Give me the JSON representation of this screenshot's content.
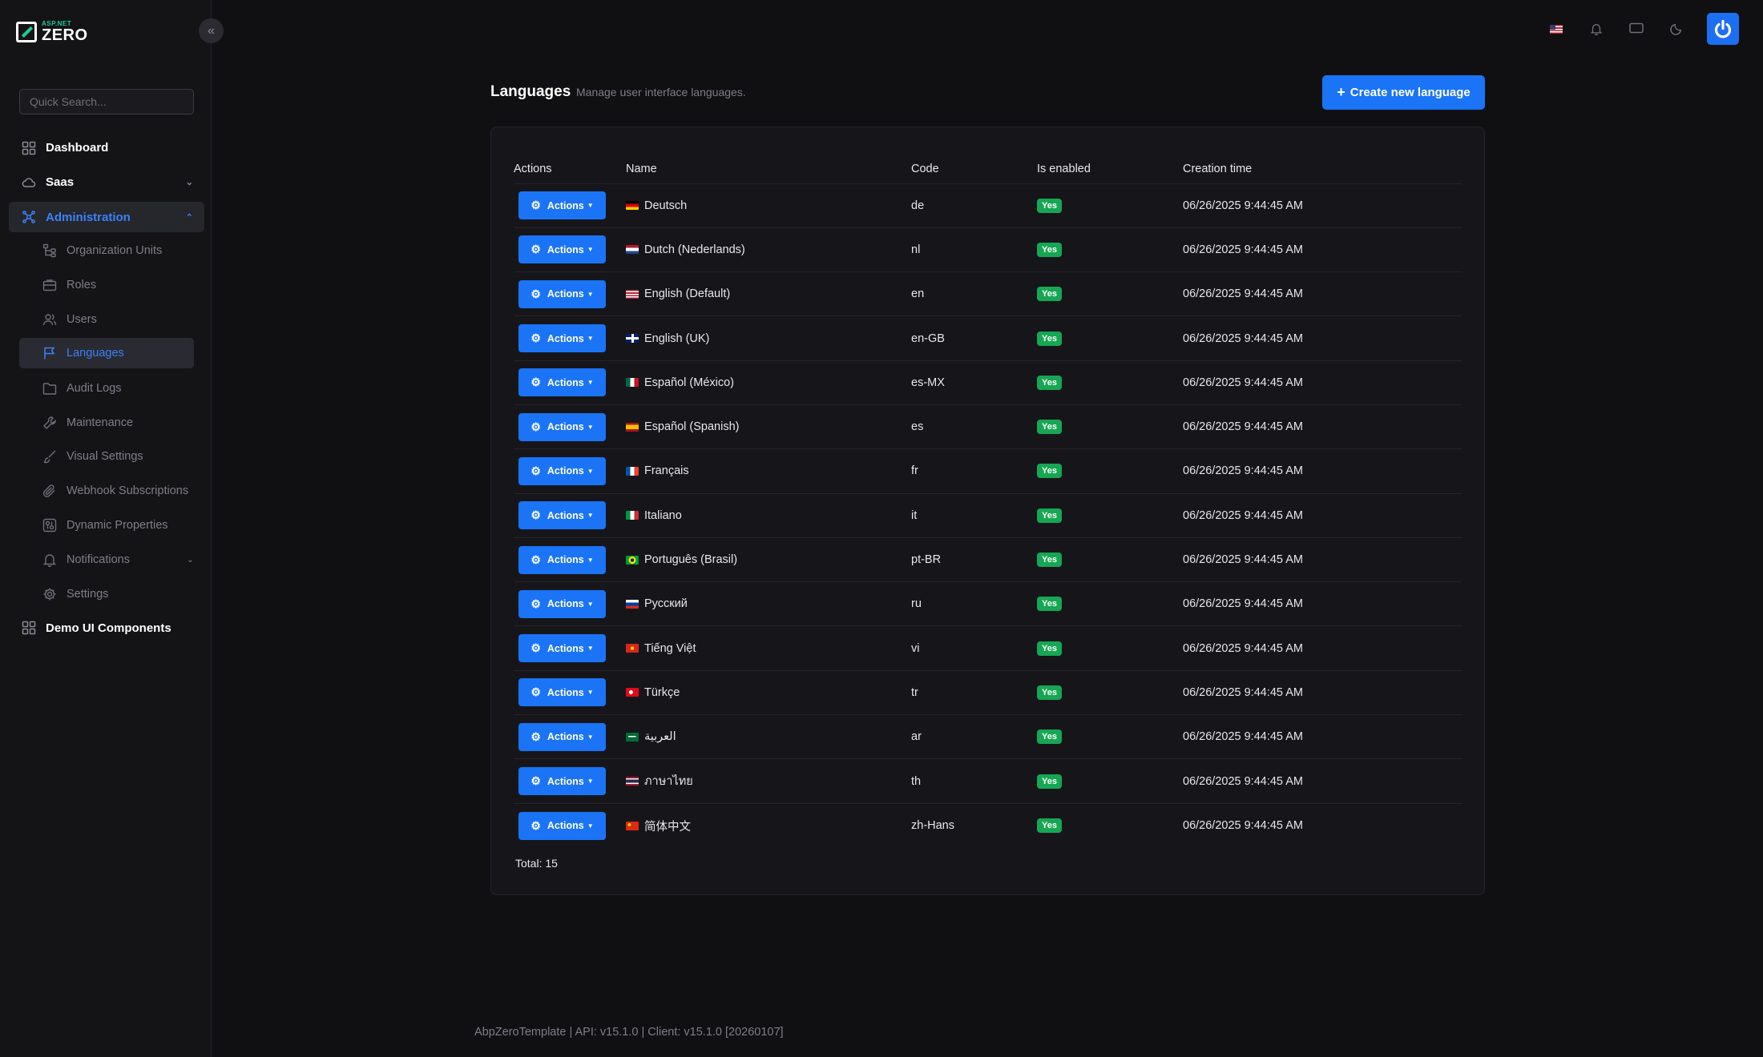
{
  "brand": {
    "small": "ASP.NET",
    "big": "ZERO"
  },
  "sidebar": {
    "search_placeholder": "Quick Search...",
    "items": [
      {
        "label": "Dashboard"
      },
      {
        "label": "Saas"
      },
      {
        "label": "Administration"
      },
      {
        "label": "Demo UI Components"
      }
    ],
    "admin_items": [
      {
        "label": "Organization Units"
      },
      {
        "label": "Roles"
      },
      {
        "label": "Users"
      },
      {
        "label": "Languages"
      },
      {
        "label": "Audit Logs"
      },
      {
        "label": "Maintenance"
      },
      {
        "label": "Visual Settings"
      },
      {
        "label": "Webhook Subscriptions"
      },
      {
        "label": "Dynamic Properties"
      },
      {
        "label": "Notifications"
      },
      {
        "label": "Settings"
      }
    ]
  },
  "topbar": {
    "icons": [
      "us-flag-icon",
      "bell-icon",
      "chat-icon",
      "moon-icon",
      "power-icon"
    ]
  },
  "page": {
    "title": "Languages",
    "subtitle": "Manage user interface languages.",
    "create_label": "Create new language"
  },
  "table": {
    "headers": {
      "actions": "Actions",
      "name": "Name",
      "code": "Code",
      "enabled": "Is enabled",
      "created": "Creation time"
    },
    "action_label": "Actions",
    "rows": [
      {
        "name": "Deutsch",
        "code": "de",
        "enabled": "Yes",
        "created": "06/26/2025 9:44:45 AM",
        "flag": "de"
      },
      {
        "name": "Dutch (Nederlands)",
        "code": "nl",
        "enabled": "Yes",
        "created": "06/26/2025 9:44:45 AM",
        "flag": "nl"
      },
      {
        "name": "English  (Default)",
        "code": "en",
        "enabled": "Yes",
        "created": "06/26/2025 9:44:45 AM",
        "flag": "us"
      },
      {
        "name": "English (UK)",
        "code": "en-GB",
        "enabled": "Yes",
        "created": "06/26/2025 9:44:45 AM",
        "flag": "gb"
      },
      {
        "name": "Español (México)",
        "code": "es-MX",
        "enabled": "Yes",
        "created": "06/26/2025 9:44:45 AM",
        "flag": "mx"
      },
      {
        "name": "Español (Spanish)",
        "code": "es",
        "enabled": "Yes",
        "created": "06/26/2025 9:44:45 AM",
        "flag": "es"
      },
      {
        "name": "Français",
        "code": "fr",
        "enabled": "Yes",
        "created": "06/26/2025 9:44:45 AM",
        "flag": "fr"
      },
      {
        "name": "Italiano",
        "code": "it",
        "enabled": "Yes",
        "created": "06/26/2025 9:44:45 AM",
        "flag": "it"
      },
      {
        "name": "Português (Brasil)",
        "code": "pt-BR",
        "enabled": "Yes",
        "created": "06/26/2025 9:44:45 AM",
        "flag": "br"
      },
      {
        "name": "Pусский",
        "code": "ru",
        "enabled": "Yes",
        "created": "06/26/2025 9:44:45 AM",
        "flag": "ru"
      },
      {
        "name": "Tiếng Việt",
        "code": "vi",
        "enabled": "Yes",
        "created": "06/26/2025 9:44:45 AM",
        "flag": "vn"
      },
      {
        "name": "Türkçe",
        "code": "tr",
        "enabled": "Yes",
        "created": "06/26/2025 9:44:45 AM",
        "flag": "tr"
      },
      {
        "name": "العربية",
        "code": "ar",
        "enabled": "Yes",
        "created": "06/26/2025 9:44:45 AM",
        "flag": "sa"
      },
      {
        "name": "ภาษาไทย",
        "code": "th",
        "enabled": "Yes",
        "created": "06/26/2025 9:44:45 AM",
        "flag": "th"
      },
      {
        "name": "简体中文",
        "code": "zh-Hans",
        "enabled": "Yes",
        "created": "06/26/2025 9:44:45 AM",
        "flag": "cn"
      }
    ],
    "total": "Total: 15"
  },
  "footer": {
    "text": "AbpZeroTemplate | API: v15.1.0 | Client: v15.1.0 [20260107]"
  },
  "colors": {
    "accent": "#1b74f5",
    "success": "#17a654",
    "background": "#101012"
  }
}
